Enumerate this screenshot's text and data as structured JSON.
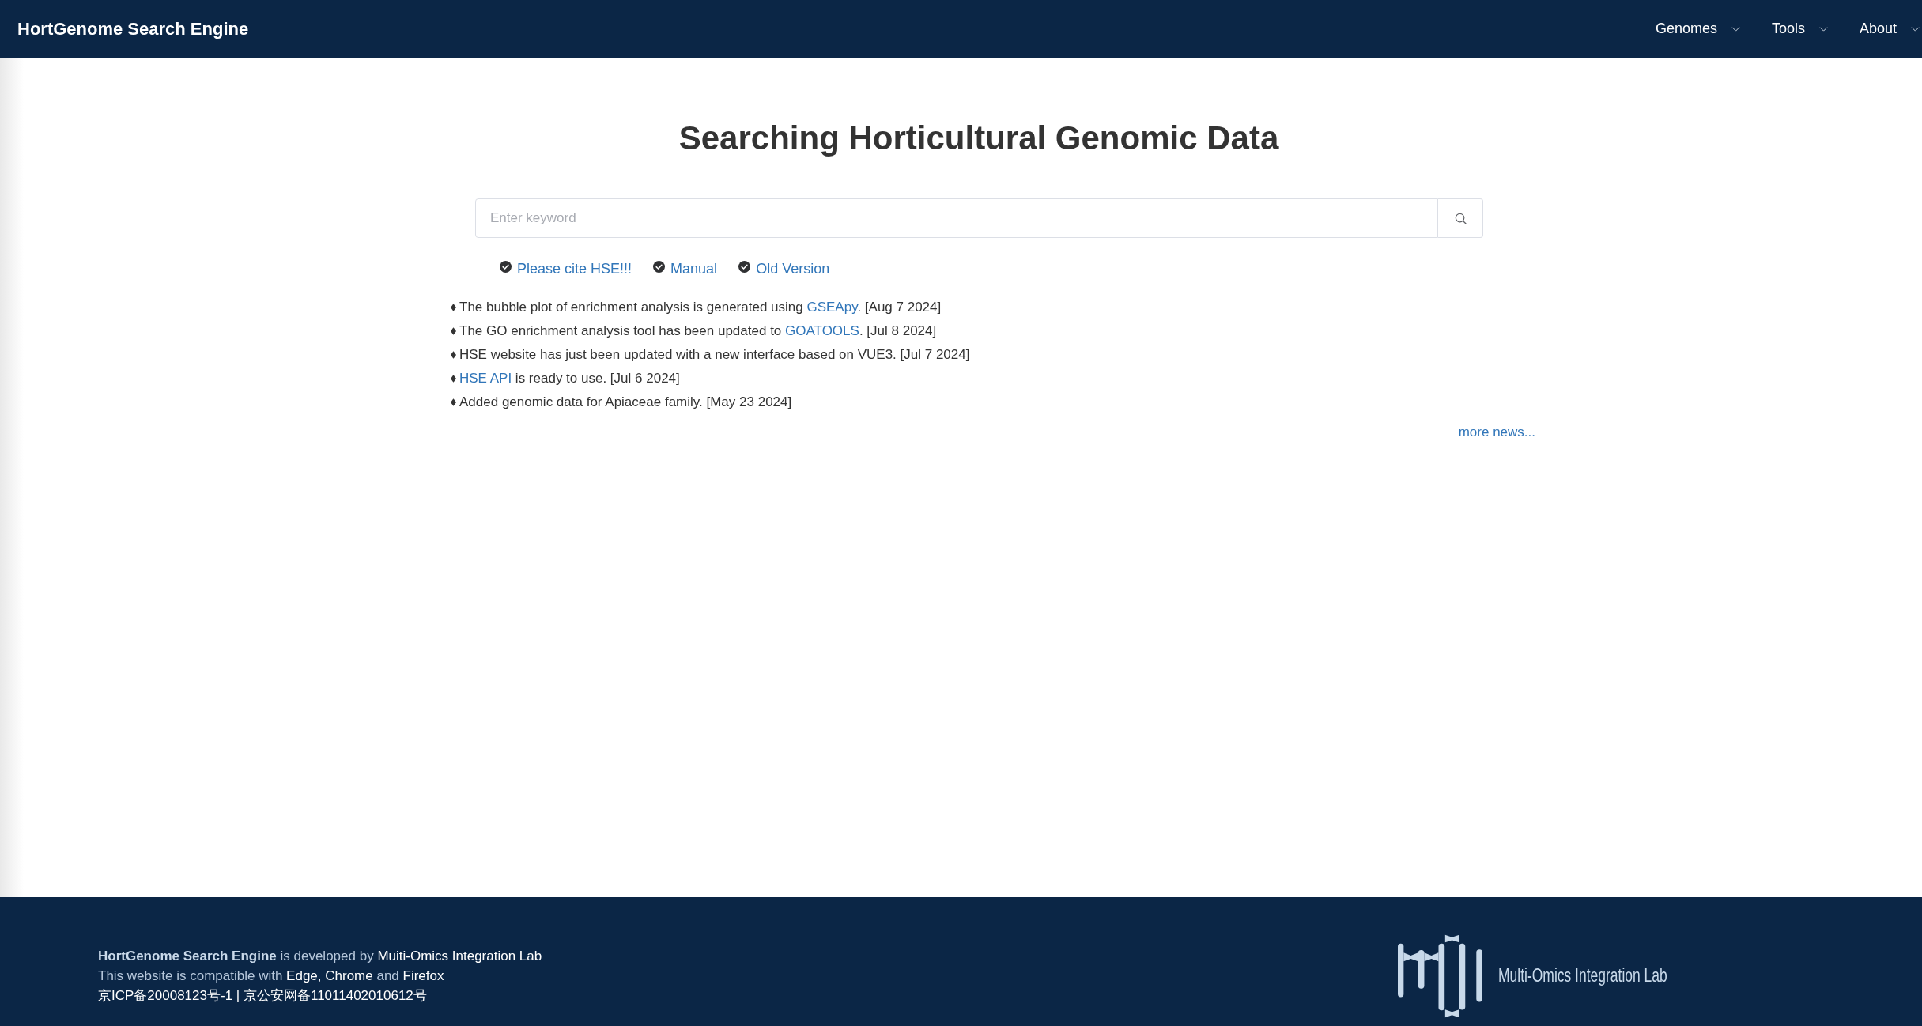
{
  "header": {
    "title": "HortGenome Search Engine",
    "nav": [
      {
        "label": "Genomes"
      },
      {
        "label": "Tools"
      },
      {
        "label": "About"
      }
    ]
  },
  "main": {
    "heading": "Searching Horticultural Genomic Data",
    "search": {
      "placeholder": "Enter keyword"
    },
    "quick_links": [
      {
        "label": "Please cite HSE!!!"
      },
      {
        "label": "Manual"
      },
      {
        "label": "Old Version"
      }
    ],
    "news": [
      {
        "parts": [
          {
            "kind": "text",
            "text": "The bubble plot of enrichment analysis is generated using "
          },
          {
            "kind": "link",
            "text": "GSEApy"
          },
          {
            "kind": "text",
            "text": ". [Aug 7 2024]"
          }
        ]
      },
      {
        "parts": [
          {
            "kind": "text",
            "text": "The GO enrichment analysis tool has been updated to "
          },
          {
            "kind": "link",
            "text": "GOATOOLS"
          },
          {
            "kind": "text",
            "text": ". [Jul 8 2024]"
          }
        ]
      },
      {
        "parts": [
          {
            "kind": "text",
            "text": "HSE website has just been updated with a new interface based on VUE3. [Jul 7 2024]"
          }
        ]
      },
      {
        "parts": [
          {
            "kind": "link",
            "text": "HSE API"
          },
          {
            "kind": "text",
            "text": " is ready to use. [Jul 6 2024]"
          }
        ]
      },
      {
        "parts": [
          {
            "kind": "text",
            "text": "Added genomic data for Apiaceae family. [May 23 2024]"
          }
        ]
      }
    ],
    "more_link": "more news..."
  },
  "footer": {
    "lines": [
      {
        "parts": [
          {
            "kind": "strong",
            "text": "HortGenome Search Engine"
          },
          {
            "kind": "text",
            "text": " is developed by "
          },
          {
            "kind": "link",
            "text": "Muiti-Omics Integration Lab"
          }
        ]
      },
      {
        "parts": [
          {
            "kind": "text",
            "text": "This website is compatible with "
          },
          {
            "kind": "highlight",
            "text": "Edge, Chrome"
          },
          {
            "kind": "text",
            "text": " and "
          },
          {
            "kind": "highlight",
            "text": "Firefox"
          }
        ]
      },
      {
        "parts": [
          {
            "kind": "highlight",
            "text": "京ICP备20008123号-1 | 京公安网备11011402010612号"
          }
        ]
      }
    ],
    "lab_name": "Multi-Omics Integration Lab"
  }
}
